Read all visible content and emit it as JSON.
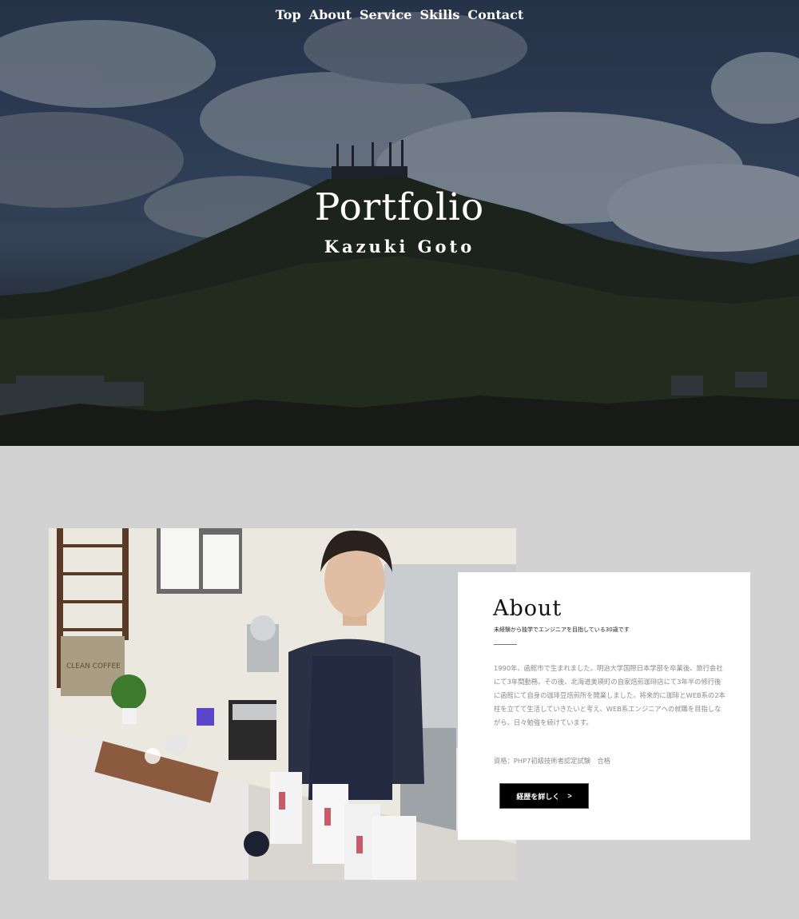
{
  "nav": {
    "items": [
      "Top",
      "About",
      "Service",
      "Skills",
      "Contact"
    ]
  },
  "hero": {
    "title": "Portfolio",
    "subtitle": "Kazuki Goto"
  },
  "about": {
    "heading": "About",
    "tagline": "未経験から独学でエンジニアを目指している30歳です",
    "bio": "1990年、函館市で生まれました。明治大学国際日本学部を卒業後、旅行会社にて3年間勤務。その後、北海道美瑛町の自家焙煎珈琲店にて3年半の修行後に函館にて自身の珈琲豆焙煎所を開業しました。将来的に珈琲とWEB系の2本柱を立てて生活していきたいと考え、WEB系エンジニアへの就職を目指しながら、日々勉強を続けています。",
    "certification": "資格：PHP7初級技術者認定試験　合格",
    "button_label": "経歴を詳しく",
    "button_arrow": ">",
    "photo_sign": "CLEAN COFFEE"
  },
  "colors": {
    "section_bg": "#d2d2d2",
    "card_bg": "#ffffff",
    "button_bg": "#000000"
  }
}
